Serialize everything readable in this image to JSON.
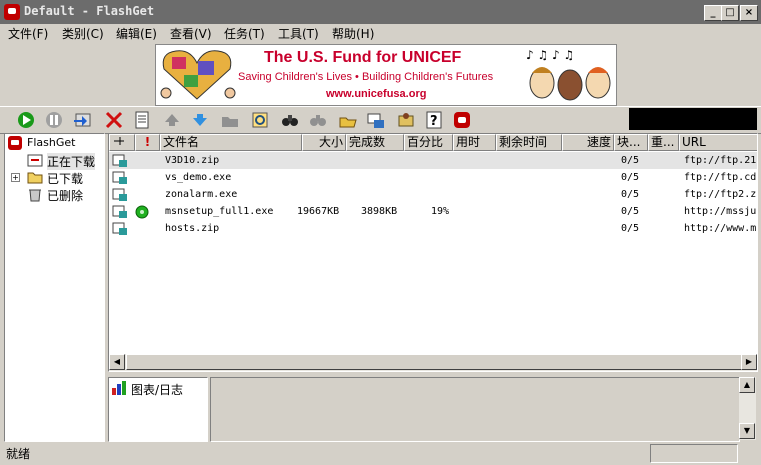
{
  "window": {
    "title": "Default - FlashGet"
  },
  "menu": [
    "文件(F)",
    "类别(C)",
    "编辑(E)",
    "查看(V)",
    "任务(T)",
    "工具(T)",
    "帮助(H)"
  ],
  "banner": {
    "title": "The U.S. Fund for UNICEF",
    "subtitle": "Saving Children's Lives • Building Children's Futures",
    "url": "www.unicefusa.org"
  },
  "toolbar": {
    "icons": [
      "start-icon",
      "pause-icon",
      "new-download-icon",
      "delete-icon",
      "properties-icon",
      "move-up-icon",
      "move-down-icon",
      "open-folder-icon",
      "find-icon",
      "binoculars-icon",
      "mirror-icon",
      "open-file-icon",
      "dial-icon",
      "settings-icon",
      "help-icon",
      "flashget-icon"
    ]
  },
  "tree": {
    "root": "FlashGet",
    "items": [
      {
        "label": "正在下载",
        "selected": true
      },
      {
        "label": "已下载",
        "selected": false
      },
      {
        "label": "已删除",
        "selected": false
      }
    ]
  },
  "list": {
    "columns": [
      "",
      "!",
      "文件名",
      "大小",
      "完成数",
      "百分比",
      "用时",
      "剩余时间",
      "速度",
      "块...",
      "重...",
      "URL"
    ],
    "rows": [
      {
        "name": "V3D10.zip",
        "size": "",
        "done": "",
        "percent": "",
        "blocks": "0/5",
        "url": "ftp://ftp.21",
        "selected": true,
        "active": false
      },
      {
        "name": "vs_demo.exe",
        "size": "",
        "done": "",
        "percent": "",
        "blocks": "0/5",
        "url": "ftp://ftp.cd",
        "selected": false,
        "active": false
      },
      {
        "name": "zonalarm.exe",
        "size": "",
        "done": "",
        "percent": "",
        "blocks": "0/5",
        "url": "ftp://ftp2.z",
        "selected": false,
        "active": false
      },
      {
        "name": "msnsetup_full1.exe",
        "size": "19667KB",
        "done": "3898KB",
        "percent": "19%",
        "blocks": "0/5",
        "url": "http://mssju",
        "selected": false,
        "active": true
      },
      {
        "name": "hosts.zip",
        "size": "",
        "done": "",
        "percent": "",
        "blocks": "0/5",
        "url": "http://www.m",
        "selected": false,
        "active": false
      }
    ]
  },
  "log": {
    "tab_label": "图表/日志"
  },
  "status": {
    "text": "就绪"
  },
  "colors": {
    "titlebar": "#6c6c6c",
    "banner_red": "#c8002c",
    "face": "#d4d0c8"
  }
}
